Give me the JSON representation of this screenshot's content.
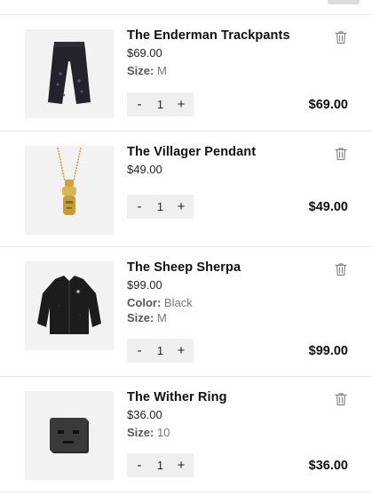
{
  "cart": {
    "items": [
      {
        "title": "The Enderman Trackpants",
        "price": "$69.00",
        "options": [
          {
            "label": "Size:",
            "value": "M"
          }
        ],
        "quantity": "1",
        "minus": "-",
        "plus": "+",
        "line_total": "$69.00",
        "image": "black-trackpants-image"
      },
      {
        "title": "The Villager Pendant",
        "price": "$49.00",
        "options": [],
        "quantity": "1",
        "minus": "-",
        "plus": "+",
        "line_total": "$49.00",
        "image": "gold-pendant-image"
      },
      {
        "title": "The Sheep Sherpa",
        "price": "$99.00",
        "options": [
          {
            "label": "Color:",
            "value": "Black"
          },
          {
            "label": "Size:",
            "value": "M"
          }
        ],
        "quantity": "1",
        "minus": "-",
        "plus": "+",
        "line_total": "$99.00",
        "image": "black-sherpa-jacket-image"
      },
      {
        "title": "The Wither Ring",
        "price": "$36.00",
        "options": [
          {
            "label": "Size:",
            "value": "10"
          }
        ],
        "quantity": "1",
        "minus": "-",
        "plus": "+",
        "line_total": "$36.00",
        "image": "wither-ring-image"
      }
    ],
    "icons": {
      "remove": "trash-icon"
    }
  }
}
